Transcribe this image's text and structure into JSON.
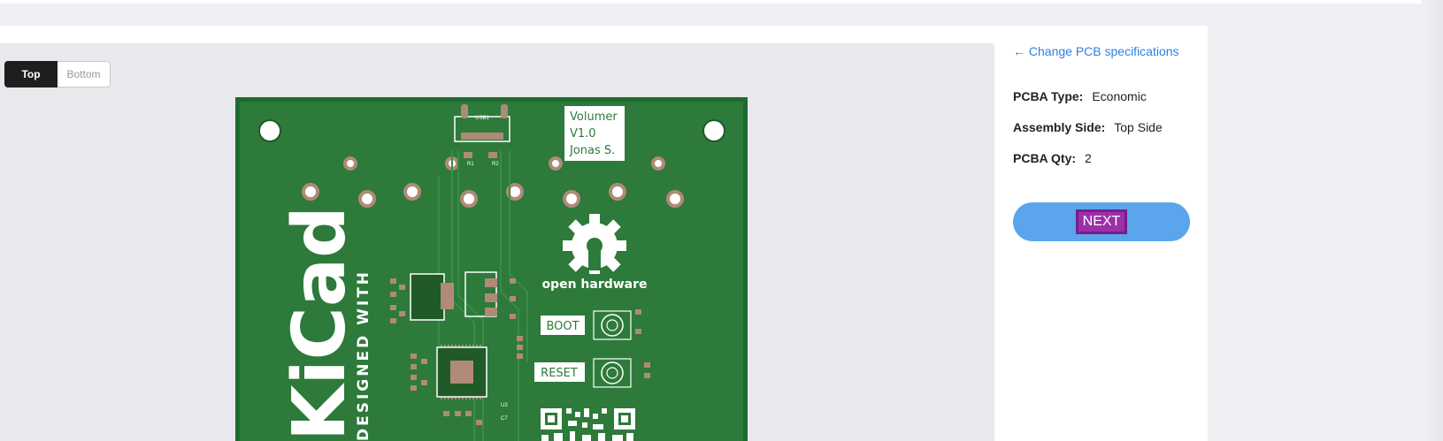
{
  "view_toggle": {
    "top_label": "Top",
    "bottom_label": "Bottom",
    "selected": "Top"
  },
  "pcb": {
    "silk_text": {
      "label_box": [
        "Volumer",
        "V1.0",
        "Jonas S."
      ],
      "usb": "USB1",
      "r1": "R1",
      "r2": "R2",
      "kicad": "KiCad",
      "designed_with": "DESIGNED WITH",
      "open_hardware": "open hardware",
      "boot": "BOOT",
      "reset": "RESET",
      "u3": "U3",
      "c7": "C7"
    },
    "colors": {
      "board": "#2d7a3a",
      "copper": "#b08a78",
      "silk": "#ffffff"
    }
  },
  "sidebar": {
    "change_link": "← Change PCB specifications",
    "specs": [
      {
        "label": "PCBA Type:",
        "value": "Economic"
      },
      {
        "label": "Assembly Side:",
        "value": "Top Side"
      },
      {
        "label": "PCBA Qty:",
        "value": "2"
      }
    ],
    "next_label": "NEXT"
  },
  "colors": {
    "accent": "#5aa5ec",
    "link": "#2f7fe0",
    "highlight": "#9b30a8"
  }
}
